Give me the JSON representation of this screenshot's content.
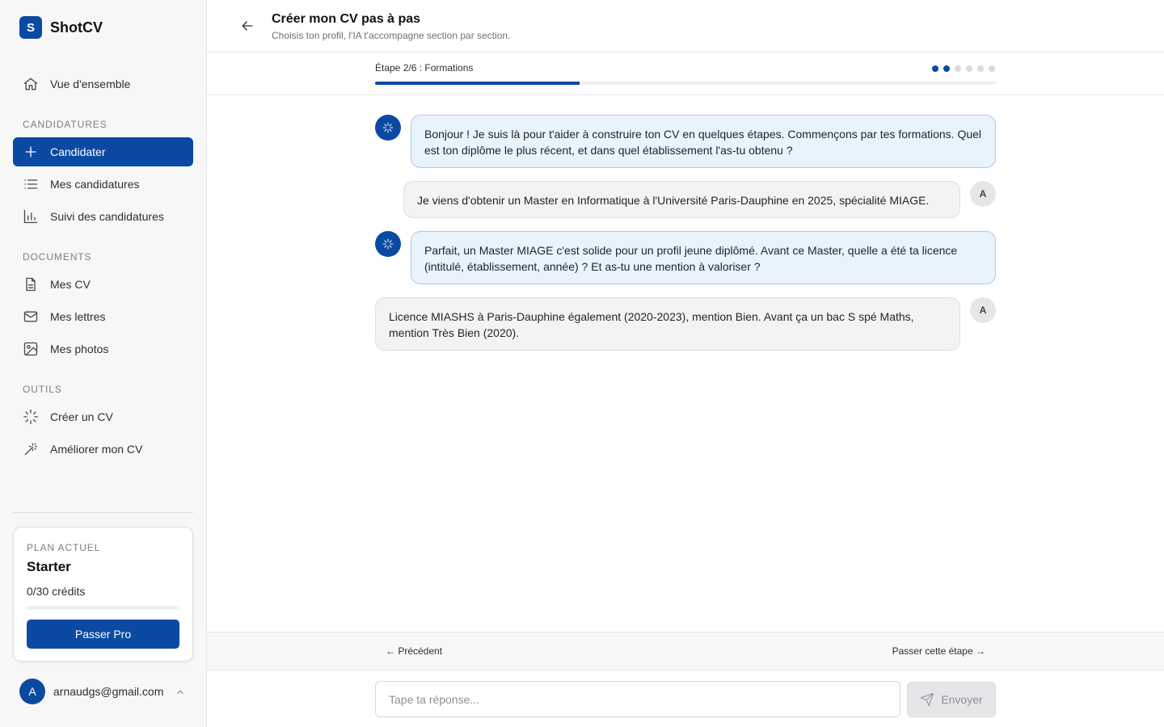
{
  "brand": {
    "logo_letter": "S",
    "name": "ShotCV"
  },
  "sidebar": {
    "overview": "Vue d'ensemble",
    "section_candidatures": "CANDIDATURES",
    "candidater": "Candidater",
    "mes_candidatures": "Mes candidatures",
    "suivi": "Suivi des candidatures",
    "section_documents": "DOCUMENTS",
    "mes_cv": "Mes CV",
    "mes_lettres": "Mes lettres",
    "mes_photos": "Mes photos",
    "section_outils": "OUTILS",
    "creer_cv": "Créer un CV",
    "ameliorer_cv": "Améliorer mon CV"
  },
  "plan": {
    "label": "PLAN ACTUEL",
    "name": "Starter",
    "credits": "0/30 crédits",
    "credits_used_fraction": 0,
    "cta": "Passer Pro"
  },
  "user": {
    "avatar_letter": "A",
    "email": "arnaudgs@gmail.com"
  },
  "header": {
    "title": "Créer mon CV pas à pas",
    "subtitle": "Choisis ton profil, l'IA t'accompagne section par section."
  },
  "step": {
    "label": "Étape 2/6 : Formations",
    "current": 2,
    "total": 6,
    "progress_fraction": 0.33
  },
  "messages": [
    {
      "role": "assistant",
      "text": "Bonjour ! Je suis là pour t'aider à construire ton CV en quelques étapes. Commençons par tes formations. Quel est ton diplôme le plus récent, et dans quel établissement l'as-tu obtenu ?"
    },
    {
      "role": "user",
      "avatar": "A",
      "text": "Je viens d'obtenir un Master en Informatique à l'Université Paris-Dauphine en 2025, spécialité MIAGE."
    },
    {
      "role": "assistant",
      "text": "Parfait, un Master MIAGE c'est solide pour un profil jeune diplômé. Avant ce Master, quelle a été ta licence (intitulé, établissement, année) ? Et as-tu une mention à valoriser ?"
    },
    {
      "role": "user",
      "avatar": "A",
      "text": "Licence MIASHS à Paris-Dauphine également (2020-2023), mention Bien. Avant ça un bac S spé Maths, mention Très Bien (2020)."
    }
  ],
  "footer": {
    "prev": "← Précédent",
    "skip": "Passer cette étape →"
  },
  "composer": {
    "placeholder": "Tape ta réponse...",
    "value": "",
    "send": "Envoyer"
  },
  "colors": {
    "accent": "#0b4aa2",
    "bot_bubble": "#e8f3fc",
    "user_bubble": "#f3f3f4"
  }
}
